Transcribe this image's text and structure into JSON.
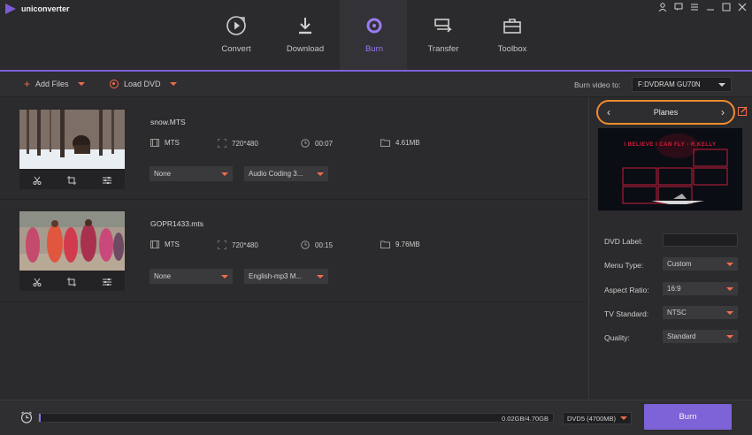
{
  "app": {
    "title": "uniconverter"
  },
  "colors": {
    "accent": "#7d62d8",
    "highlight": "#f26b4b",
    "orange_ring": "#f08a2e"
  },
  "nav": {
    "tabs": [
      {
        "label": "Convert",
        "icon": "convert-icon"
      },
      {
        "label": "Download",
        "icon": "download-icon"
      },
      {
        "label": "Burn",
        "icon": "burn-disc-icon",
        "active": true
      },
      {
        "label": "Transfer",
        "icon": "transfer-icon"
      },
      {
        "label": "Toolbox",
        "icon": "toolbox-icon"
      }
    ]
  },
  "toolbar": {
    "add_files": "Add Files",
    "load_dvd": "Load DVD",
    "burn_to_label": "Burn video to:",
    "burn_to_value": "F:DVDRAM GU70N"
  },
  "files": [
    {
      "name": "snow.MTS",
      "format": "MTS",
      "resolution": "720*480",
      "duration": "00:07",
      "size": "4.61MB",
      "subtitle": "None",
      "audio": "Audio Coding 3..."
    },
    {
      "name": "GOPR1433.mts",
      "format": "MTS",
      "resolution": "720*480",
      "duration": "00:15",
      "size": "9.76MB",
      "subtitle": "None",
      "audio": "English-mp3 M..."
    }
  ],
  "template": {
    "name": "Planes",
    "preview_text": "I BELIEVE I CAN FLY - R.KELLY"
  },
  "settings": {
    "dvd_label": {
      "label": "DVD Label:",
      "value": ""
    },
    "menu_type": {
      "label": "Menu Type:",
      "value": "Custom"
    },
    "aspect_ratio": {
      "label": "Aspect Ratio:",
      "value": "16:9"
    },
    "tv_standard": {
      "label": "TV Standard:",
      "value": "NTSC"
    },
    "quality": {
      "label": "Quality:",
      "value": "Standard"
    }
  },
  "bottom": {
    "progress_text": "0.02GB/4.70GB",
    "progress_fraction": 0.004,
    "disc_type": "DVD5 (4700MB)",
    "burn_label": "Burn"
  }
}
